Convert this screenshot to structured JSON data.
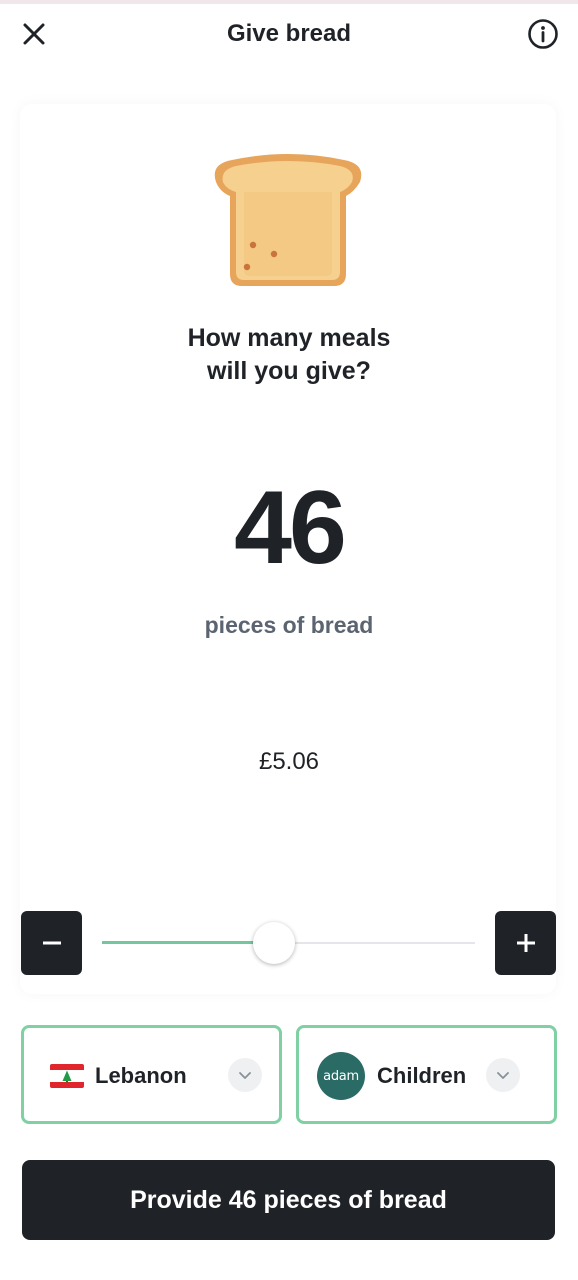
{
  "header": {
    "title": "Give bread",
    "close_icon": "close-icon",
    "info_icon": "info-icon"
  },
  "main": {
    "icon": "bread-toast-icon",
    "question_line1": "How many meals",
    "question_line2": "will you give?",
    "count": "46",
    "unit": "pieces of bread",
    "price": "£5.06"
  },
  "slider": {
    "level": 0.46,
    "minus_icon": "minus-icon",
    "plus_icon": "plus-icon"
  },
  "selectors": {
    "country": {
      "label": "Lebanon",
      "icon": "lebanon-flag-icon"
    },
    "group": {
      "label": "Children",
      "logo_text": "adam"
    }
  },
  "cta": {
    "label": "Provide 46 pieces of bread"
  },
  "colors": {
    "primary": "#1f2328",
    "accent": "#74c69d",
    "selector_border": "#7fd0a3",
    "muted_text": "#5b6470",
    "logo_bg": "#2b6b66"
  }
}
